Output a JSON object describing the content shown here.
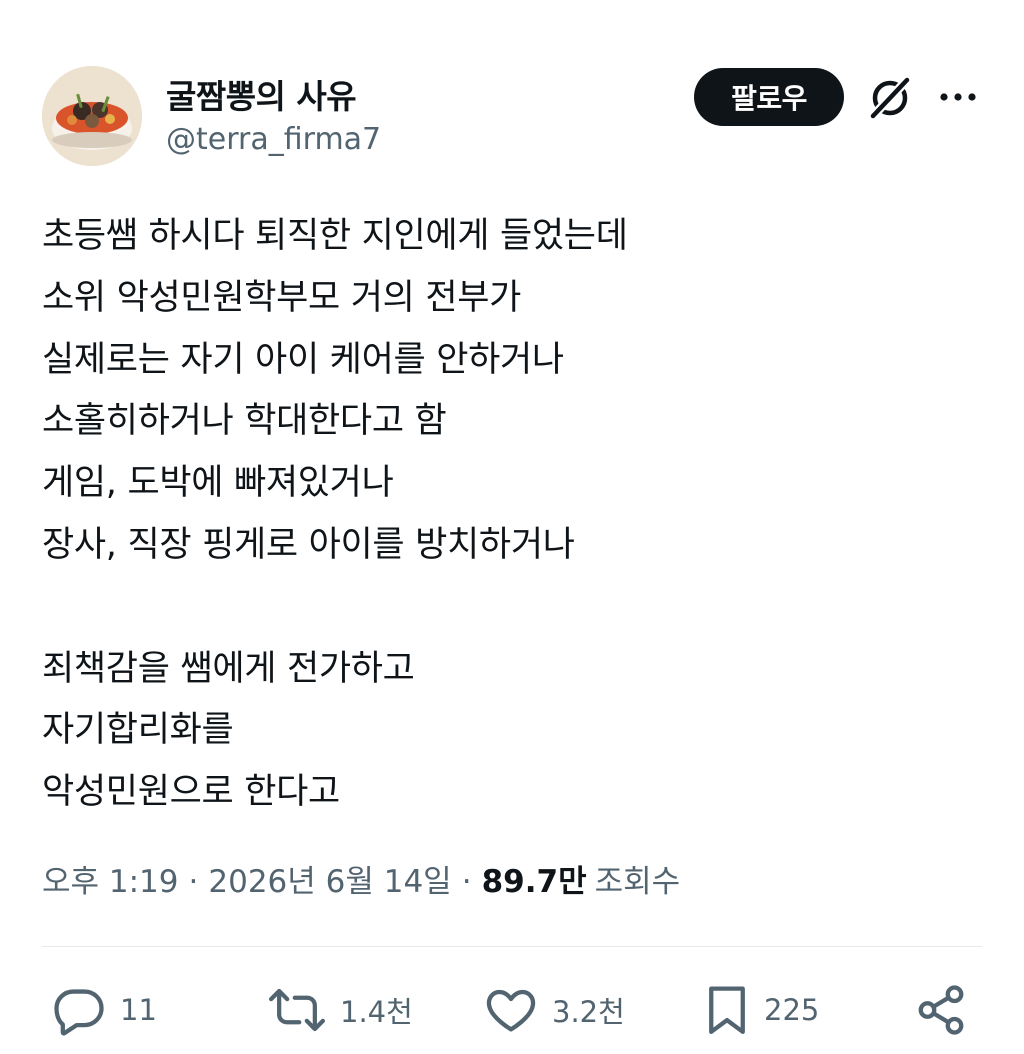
{
  "author": {
    "display_name": "굴짬뽕의 사유",
    "handle": "@terra_firma7",
    "avatar_icon": "avatar-food-bowl"
  },
  "header_actions": {
    "follow_label": "팔로우",
    "grok_icon": "grok-icon",
    "more_icon": "more-icon"
  },
  "post": {
    "lines": [
      "초등쌤 하시다 퇴직한 지인에게 들었는데",
      "소위 악성민원학부모 거의 전부가",
      "실제로는 자기 아이 케어를 안하거나",
      "소홀히하거나 학대한다고 함",
      "게임, 도박에 빠져있거나",
      "장사, 직장 핑게로 아이를 방치하거나",
      "",
      "죄책감을 쌤에게 전가하고",
      "자기합리화를",
      "악성민원으로 한다고"
    ]
  },
  "meta": {
    "time": "오후 1:19",
    "date": "2026년 6월 14일",
    "views_count": "89.7만",
    "views_label": "조회수",
    "separator": "·"
  },
  "actions": {
    "reply_count": "11",
    "repost_count": "1.4천",
    "like_count": "3.2천",
    "bookmark_count": "225"
  },
  "colors": {
    "text_primary": "#0f1419",
    "text_secondary": "#536471",
    "follow_bg": "#0f1419",
    "divider": "#e6e9ec"
  }
}
